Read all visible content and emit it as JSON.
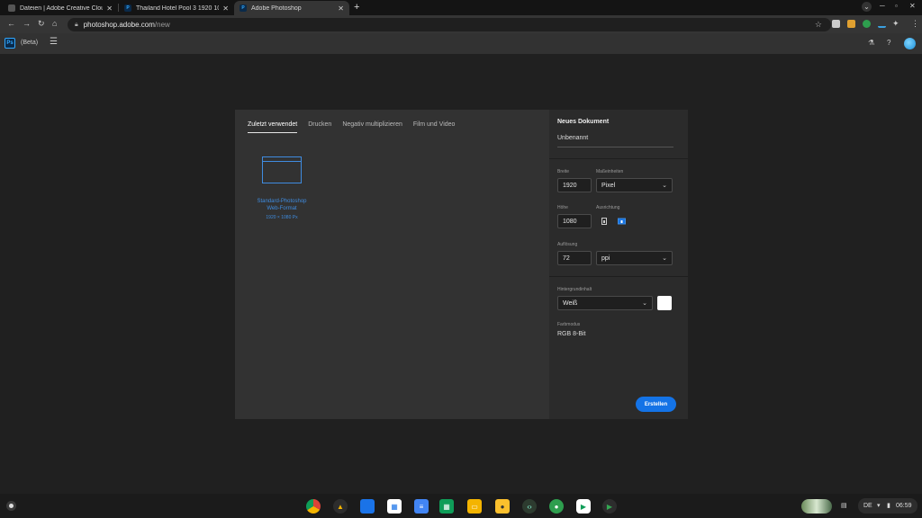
{
  "browser": {
    "tabs": [
      {
        "title": "Dateien | Adobe Creative Cloud",
        "close": "✕"
      },
      {
        "title": "Thailand Hotel Pool 3 1920 108…",
        "close": "✕"
      },
      {
        "title": "Adobe Photoshop",
        "close": "✕"
      }
    ],
    "new_tab": "+",
    "url_domain": "photoshop.adobe.com",
    "url_path": "/new"
  },
  "app": {
    "logo": "Ps",
    "beta": "(Beta)"
  },
  "dialog": {
    "tabs": [
      "Zuletzt verwendet",
      "Drucken",
      "Negativ multiplizieren",
      "Film und Video"
    ],
    "preset": {
      "name": "Standard-Photoshop Web-Format",
      "size": "1920 × 1080 Px"
    },
    "panel": {
      "title": "Neues Dokument",
      "doc_name": "Unbenannt",
      "width_label": "Breite",
      "width_value": "1920",
      "units_label": "Maßeinheiten",
      "units_value": "Pixel",
      "height_label": "Höhe",
      "height_value": "1080",
      "orientation_label": "Ausrichtung",
      "resolution_label": "Auflösung",
      "resolution_value": "72",
      "resolution_unit": "ppi",
      "bg_label": "Hintergrundinhalt",
      "bg_value": "Weiß",
      "color_mode_label": "Farbmodus",
      "color_mode_value": "RGB 8-Bit",
      "create_button": "Erstellen"
    }
  },
  "tray": {
    "lang": "DE",
    "time": "06:59"
  },
  "colors": {
    "accent": "#1473e6",
    "preset_blue": "#3f8ce0",
    "background_swatch": "#ffffff"
  }
}
